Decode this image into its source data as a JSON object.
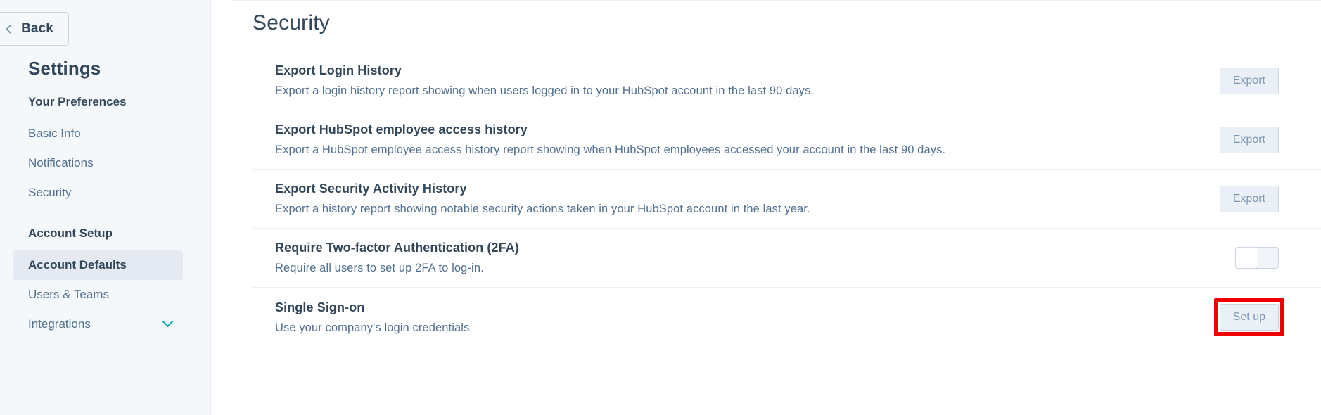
{
  "sidebar": {
    "back_button": "Back",
    "title": "Settings",
    "sections": [
      {
        "label": "Your Preferences",
        "items": [
          {
            "label": "Basic Info",
            "active": false,
            "caret": false
          },
          {
            "label": "Notifications",
            "active": false,
            "caret": false
          },
          {
            "label": "Security",
            "active": false,
            "caret": false
          }
        ]
      },
      {
        "label": "Account Setup",
        "items": [
          {
            "label": "Account Defaults",
            "active": true,
            "caret": false
          },
          {
            "label": "Users & Teams",
            "active": false,
            "caret": false
          },
          {
            "label": "Integrations",
            "active": false,
            "caret": true
          }
        ]
      }
    ]
  },
  "main": {
    "page_title": "Security",
    "rows": [
      {
        "title": "Export Login History",
        "description": "Export a login history report showing when users logged in to your HubSpot account in the last 90 days.",
        "action": {
          "type": "button",
          "label": "Export"
        }
      },
      {
        "title": "Export HubSpot employee access history",
        "description": "Export a HubSpot employee access history report showing when HubSpot employees accessed your account in the last 90 days.",
        "action": {
          "type": "button",
          "label": "Export"
        }
      },
      {
        "title": "Export Security Activity History",
        "description": "Export a history report showing notable security actions taken in your HubSpot account in the last year.",
        "action": {
          "type": "button",
          "label": "Export"
        }
      },
      {
        "title": "Require Two-factor Authentication (2FA)",
        "description": "Require all users to set up 2FA to log-in.",
        "action": {
          "type": "toggle",
          "state": "off"
        }
      },
      {
        "title": "Single Sign-on",
        "description": "Use your company's login credentials",
        "action": {
          "type": "button",
          "label": "Set up",
          "highlighted": true
        }
      }
    ]
  },
  "annotation": {
    "color": "#ee0000",
    "target": "set-up-button"
  },
  "colors": {
    "sidebar_bg": "#f5f8fa",
    "active_nav_bg": "#e5eaf2",
    "text_dark": "#33475b",
    "text_muted": "#516f90",
    "button_bg": "#eaf0f6",
    "button_border": "#cbd6e2",
    "accent_teal": "#00a4bd",
    "highlight": "#ee0000"
  }
}
